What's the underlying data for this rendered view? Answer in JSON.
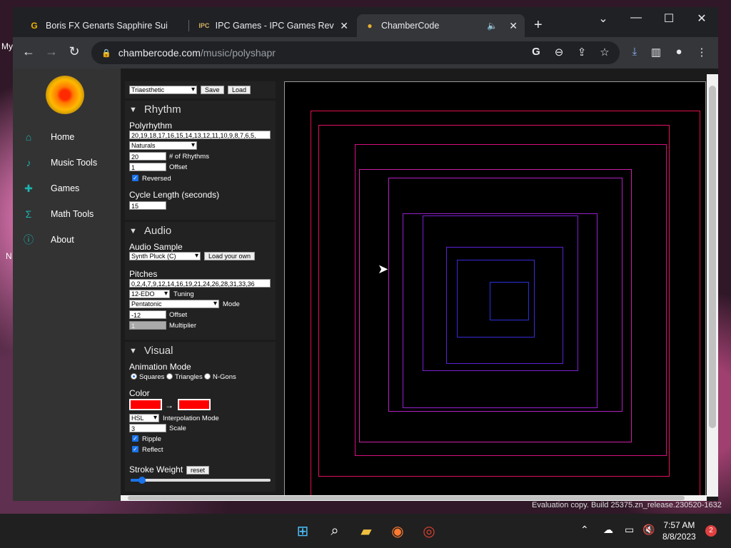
{
  "desktop": {
    "top_text": "My",
    "side_text": "N",
    "watermark": "Evaluation copy. Build 25375.zn_release.230520-1632"
  },
  "browser": {
    "tabs": [
      {
        "title": "Boris FX Genarts Sapphire Suite /",
        "favicon": "G"
      },
      {
        "title": "IPC Games - IPC Games Reviews",
        "favicon": "IPC"
      },
      {
        "title": "ChamberCode",
        "favicon": "●",
        "active": true
      }
    ],
    "url_domain": "chambercode.com",
    "url_path": "/music/polyshapr"
  },
  "sidebar": {
    "items": [
      {
        "label": "Home",
        "icon": "home-icon"
      },
      {
        "label": "Music Tools",
        "icon": "music-note-icon"
      },
      {
        "label": "Games",
        "icon": "gamepad-icon"
      },
      {
        "label": "Math Tools",
        "icon": "sigma-icon"
      },
      {
        "label": "About",
        "icon": "info-icon"
      }
    ]
  },
  "controls": {
    "preset": "Triaesthetic",
    "save_label": "Save",
    "load_label": "Load",
    "rhythm": {
      "header": "Rhythm",
      "polyrhythm_label": "Polyrhythm",
      "polyrhythm_value": "20,19,18,17,16,15,14,13,12,11,10,9,8,7,6,5,",
      "sequence": "Naturals",
      "num_rhythms": "20",
      "num_rhythms_label": "# of Rhythms",
      "offset": "1",
      "offset_label": "Offset",
      "reversed_label": "Reversed",
      "cycle_label": "Cycle Length (seconds)",
      "cycle_value": "15"
    },
    "audio": {
      "header": "Audio",
      "sample_label": "Audio Sample",
      "sample_value": "Synth Pluck (C)",
      "load_own_label": "Load your own",
      "pitches_label": "Pitches",
      "pitches_value": "0,2,4,7,9,12,14,16,19,21,24,26,28,31,33,36",
      "tuning_value": "12-EDO",
      "tuning_label": "Tuning",
      "mode_value": "Pentatonic",
      "mode_label": "Mode",
      "offset_value": "-12",
      "offset_label": "Offset",
      "multiplier_value": "1",
      "multiplier_label": "Multiplier"
    },
    "visual": {
      "header": "Visual",
      "anim_label": "Animation Mode",
      "opt_squares": "Squares",
      "opt_triangles": "Triangles",
      "opt_ngons": "N-Gons",
      "color_label": "Color",
      "color_from": "#ff0000",
      "color_to": "#ff0000",
      "interp_value": "HSL",
      "interp_label": "Interpolation Mode",
      "scale_value": "3",
      "scale_label": "Scale",
      "ripple_label": "Ripple",
      "reflect_label": "Reflect",
      "stroke_label": "Stroke Weight",
      "reset_label": "reset",
      "stroke_level": 0.08
    }
  },
  "taskbar": {
    "time": "7:57 AM",
    "date": "8/8/2023",
    "notifications": "2"
  }
}
